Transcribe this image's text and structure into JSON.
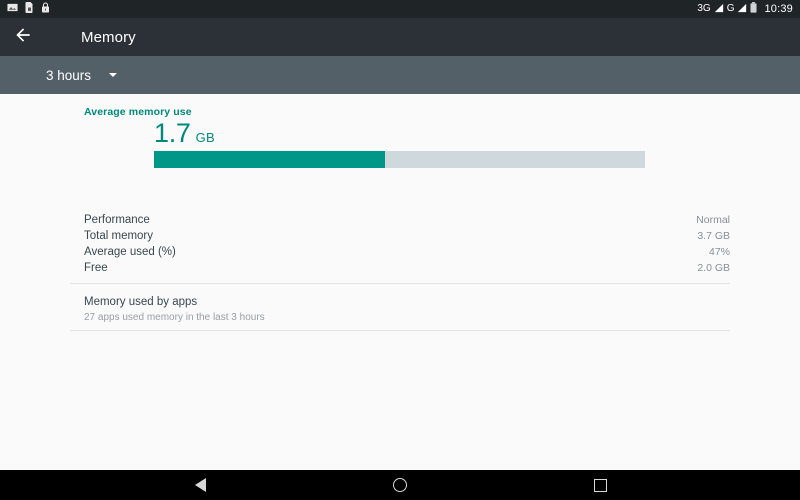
{
  "status_bar": {
    "icons": [
      "screenshot-icon",
      "sim-card-icon",
      "lock-icon"
    ],
    "network_1": "3G",
    "network_2": "G",
    "battery": "battery-icon",
    "clock": "10:39"
  },
  "app_bar": {
    "back_icon": "arrow-back-icon",
    "title": "Memory"
  },
  "sub_bar": {
    "range_label": "3 hours",
    "caret_icon": "chevron-down-icon"
  },
  "memory": {
    "section_label": "Average memory use",
    "value_number": "1.7",
    "value_unit": "GB",
    "used_percent": 47,
    "accent_color": "#009688",
    "track_color": "#cfd8dc"
  },
  "stats": [
    {
      "key": "Performance",
      "value": "Normal"
    },
    {
      "key": "Total memory",
      "value": "3.7 GB"
    },
    {
      "key": "Average used (%)",
      "value": "47%"
    },
    {
      "key": "Free",
      "value": "2.0 GB"
    }
  ],
  "apps_section": {
    "title": "Memory used by apps",
    "subtitle": "27 apps used memory in the last 3 hours"
  },
  "nav_bar": {
    "back": "nav-back-icon",
    "home": "nav-home-icon",
    "recents": "nav-recents-icon"
  }
}
